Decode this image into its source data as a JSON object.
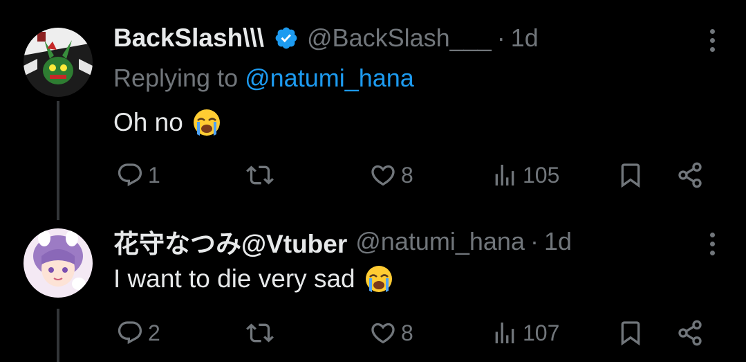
{
  "tweets": [
    {
      "author": "BackSlash\\\\\\",
      "handle": "@BackSlash___",
      "separator": "·",
      "time": "1d",
      "verified": true,
      "reply_label": "Replying to ",
      "reply_mention": "@natumi_hana",
      "text": "Oh no",
      "emoji": "loudly-crying-face",
      "replies": "1",
      "retweets": "",
      "likes": "8",
      "views": "105"
    },
    {
      "author": "花守なつみ@Vtuber",
      "handle": "@natumi_hana",
      "separator": "·",
      "time": "1d",
      "verified": false,
      "text": "I want to die very sad",
      "emoji": "loudly-crying-face",
      "replies": "2",
      "retweets": "",
      "likes": "8",
      "views": "107"
    }
  ],
  "colors": {
    "background": "#000000",
    "primary_text": "#e7e9ea",
    "secondary_text": "#71767b",
    "accent": "#1d9bf0",
    "thread_line": "#333639"
  }
}
